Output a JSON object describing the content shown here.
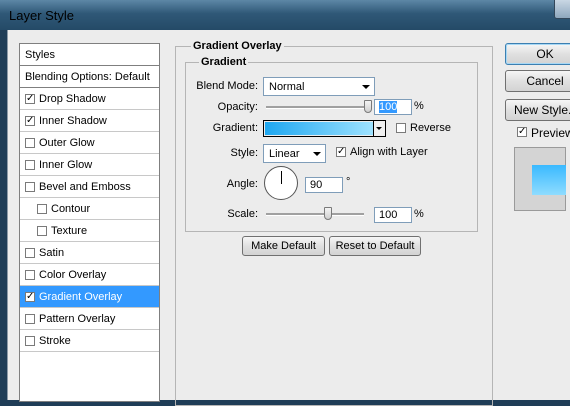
{
  "window": {
    "title": "Layer Style"
  },
  "sidebar": {
    "header": "Styles",
    "blending_options": "Blending Options: Default",
    "items": [
      {
        "label": "Drop Shadow",
        "checked": true
      },
      {
        "label": "Inner Shadow",
        "checked": true
      },
      {
        "label": "Outer Glow",
        "checked": false
      },
      {
        "label": "Inner Glow",
        "checked": false
      },
      {
        "label": "Bevel and Emboss",
        "checked": false
      },
      {
        "label": "Contour",
        "checked": false
      },
      {
        "label": "Texture",
        "checked": false
      },
      {
        "label": "Satin",
        "checked": false
      },
      {
        "label": "Color Overlay",
        "checked": false
      },
      {
        "label": "Gradient Overlay",
        "checked": true,
        "selected": true
      },
      {
        "label": "Pattern Overlay",
        "checked": false
      },
      {
        "label": "Stroke",
        "checked": false
      }
    ]
  },
  "gradient_overlay": {
    "section_title": "Gradient Overlay",
    "group_title": "Gradient",
    "blend_mode_label": "Blend Mode:",
    "blend_mode_value": "Normal",
    "opacity_label": "Opacity:",
    "opacity_value": "100",
    "opacity_unit": "%",
    "opacity_fraction": 1.0,
    "gradient_label": "Gradient:",
    "reverse_label": "Reverse",
    "reverse_checked": false,
    "style_label": "Style:",
    "style_value": "Linear",
    "align_label": "Align with Layer",
    "align_checked": true,
    "angle_label": "Angle:",
    "angle_value": "90",
    "angle_unit": "°",
    "scale_label": "Scale:",
    "scale_value": "100",
    "scale_unit": "%",
    "make_default_label": "Make Default",
    "reset_default_label": "Reset to Default"
  },
  "actions": {
    "ok_label": "OK",
    "cancel_label": "Cancel",
    "new_style_label": "New Style...",
    "preview_label": "Preview",
    "preview_checked": true
  },
  "colors": {
    "selection": "#3399ff",
    "gradient_start": "#1ea7f0",
    "gradient_end": "#9ee2ff"
  }
}
